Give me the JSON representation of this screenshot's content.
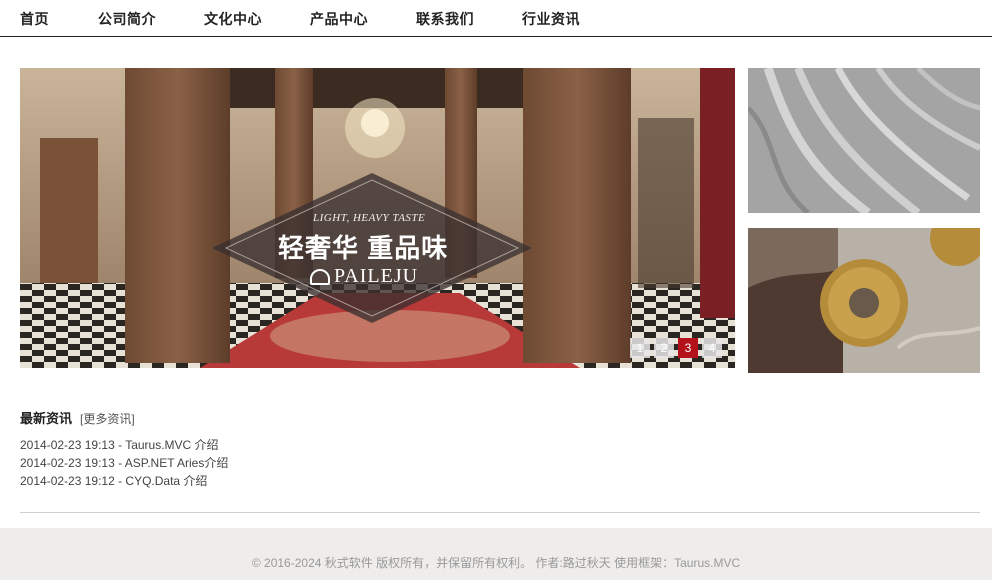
{
  "nav": {
    "items": [
      {
        "label": "首页"
      },
      {
        "label": "公司简介"
      },
      {
        "label": "文化中心"
      },
      {
        "label": "产品中心"
      },
      {
        "label": "联系我们"
      },
      {
        "label": "行业资讯"
      }
    ]
  },
  "banner": {
    "tagline": "LIGHT, HEAVY TASTE",
    "headline": "轻奢华 重品味",
    "brand": "PAILEJU",
    "pager": [
      "1",
      "2",
      "3",
      "4"
    ],
    "active_page": 3,
    "accent_color": "#b3121a"
  },
  "news": {
    "title": "最新资讯",
    "more_label": "[更多资讯]",
    "items": [
      {
        "text": "2014-02-23 19:13 - Taurus.MVC 介绍"
      },
      {
        "text": "2014-02-23 19:13 - ASP.NET Aries介绍"
      },
      {
        "text": "2014-02-23 19:12 - CYQ.Data 介绍"
      }
    ]
  },
  "footer": {
    "text": "© 2016-2024 秋式软件 版权所有，并保留所有权利。 作者:路过秋天  使用框架：Taurus.MVC"
  }
}
